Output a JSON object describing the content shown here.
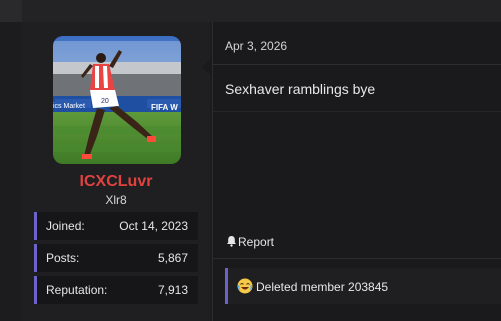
{
  "user": {
    "username": "ICXCLuvr",
    "title": "Xlr8",
    "username_color": "#e0433f",
    "avatar_icon": "soccer-player-photo",
    "stats": [
      {
        "label": "Joined:",
        "value": "Oct 14, 2023"
      },
      {
        "label": "Posts:",
        "value": "5,867"
      },
      {
        "label": "Reputation:",
        "value": "7,913"
      }
    ]
  },
  "post": {
    "date": "Apr 3, 2026",
    "body": "Sexhaver ramblings bye",
    "report_label": "Report",
    "report_icon": "bell-icon",
    "reaction_icon": "laughing-crying-emoji",
    "reaction_text": "Deleted member 203845"
  },
  "colors": {
    "accent": "#6b63c9",
    "background": "#1c1c1e"
  }
}
